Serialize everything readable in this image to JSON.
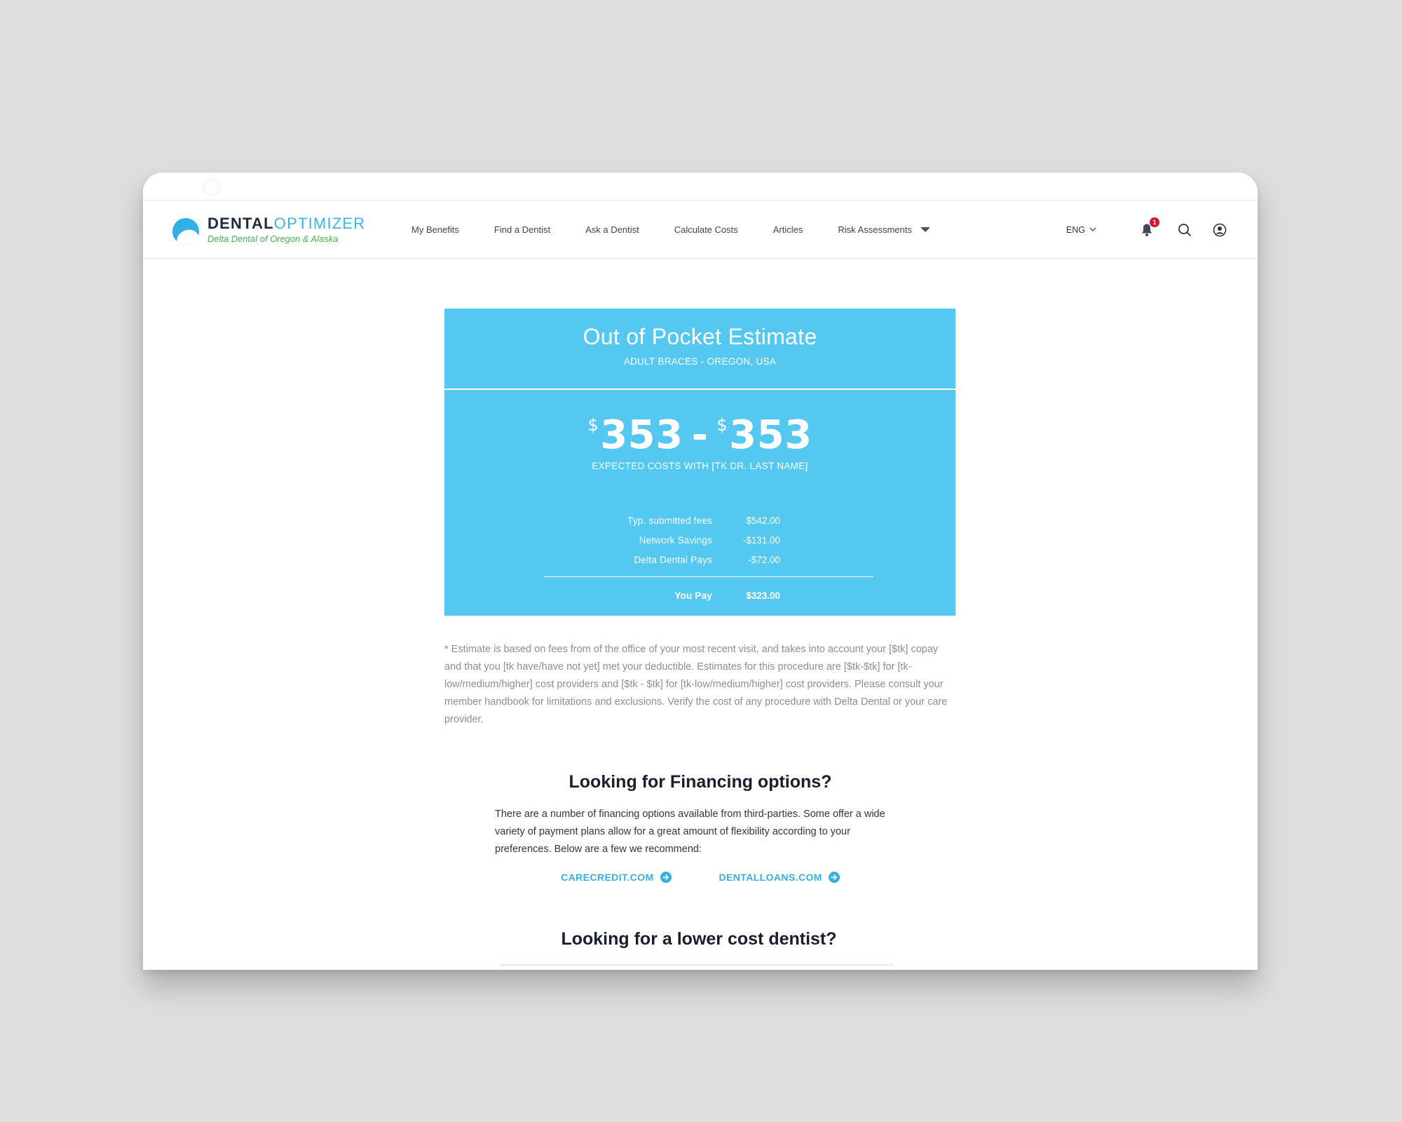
{
  "brand": {
    "name_part1": "DENTAL",
    "name_part2": "OPTIMIZER",
    "tagline": "Delta Dental of Oregon & Alaska"
  },
  "nav": {
    "items": [
      "My Benefits",
      "Find a Dentist",
      "Ask a Dentist",
      "Calculate Costs",
      "Articles"
    ],
    "dropdown_label": "Risk Assessments",
    "language": "ENG",
    "notification_count": "1",
    "icons": [
      "bell-icon",
      "search-icon",
      "account-icon"
    ]
  },
  "estimate": {
    "title": "Out of Pocket Estimate",
    "subtitle": "ADULT BRACES - OREGON, USA",
    "currency": "$",
    "low": "353",
    "dash": "-",
    "high": "353",
    "expected_label": "EXPECTED COSTS WITH [TK DR. LAST NAME]",
    "rows": [
      {
        "label": "Typ. submitted fees",
        "value": "$542.00"
      },
      {
        "label": "Network Savings",
        "value": "-$131.00"
      },
      {
        "label": "Delta Dental Pays",
        "value": "-$72.00"
      }
    ],
    "total": {
      "label": "You Pay",
      "value": "$323.00"
    }
  },
  "disclaimer": "* Estimate is based on fees from of the office of your most recent visit, and takes into account your [$tk] copay and that you [tk have/have not yet] met your deductible. Estimates for this procedure are [$tk-$tk] for [tk-low/medium/higher] cost providers and [$tk - $tk] for [tk-low/medium/higher] cost providers. Please consult your member handbook for limitations and exclusions. Verify the cost of any procedure with Delta Dental or your care provider.",
  "financing": {
    "title": "Looking for Financing options?",
    "text": "There are a number of financing options available from third-parties. Some offer a wide variety of payment plans allow for a great amount of flexibility according to your preferences. Below are a few we recommend:",
    "links": [
      "CARECREDIT.COM",
      "DENTALLOANS.COM"
    ]
  },
  "lower_cost": {
    "title": "Looking for a lower cost dentist?"
  },
  "colors": {
    "card": "#55c8f2",
    "accent": "#3aaee2",
    "brand_green": "#44b049",
    "badge": "#d0182a"
  }
}
